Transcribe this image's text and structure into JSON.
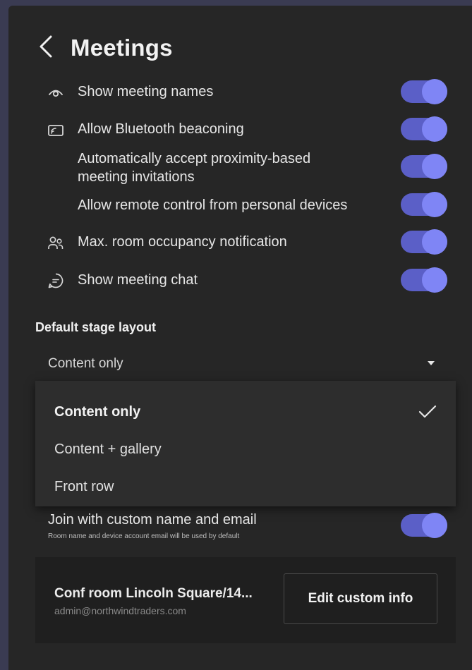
{
  "header": {
    "back_icon": "chevron-left-icon",
    "title": "Meetings"
  },
  "settings": [
    {
      "label": "Show meeting names",
      "icon": "eye-icon",
      "enabled": true
    },
    {
      "label": "Allow Bluetooth beaconing",
      "icon": "cast-icon",
      "enabled": true
    },
    {
      "label": "Automatically accept proximity-based",
      "label_line2": "meeting invitations",
      "icon": "",
      "enabled": true
    },
    {
      "label": "Allow remote control from personal devices",
      "icon": "",
      "enabled": true
    },
    {
      "label": "Max. room occupancy notification",
      "icon": "people-icon",
      "enabled": true
    },
    {
      "label": "Show meeting chat",
      "icon": "chat-icon",
      "enabled": true
    }
  ],
  "stage_layout": {
    "header": "Default stage layout",
    "selected": "Content only",
    "options": [
      {
        "label": "Content only",
        "selected": true
      },
      {
        "label": "Content + gallery",
        "selected": false
      },
      {
        "label": "Front row",
        "selected": false
      }
    ]
  },
  "custom_join": {
    "label": "Join with custom name and email",
    "sublabel": "Room name and device account email will be used by default",
    "enabled": true
  },
  "room_card": {
    "name": "Conf room Lincoln Square/14...",
    "email": "admin@northwindtraders.com",
    "edit_button_label": "Edit custom info"
  },
  "colors": {
    "panel_bg": "#262626",
    "toggle_track": "#5b5fc7",
    "toggle_knob": "#7f85f5",
    "card_bg": "#1f1f1f"
  }
}
